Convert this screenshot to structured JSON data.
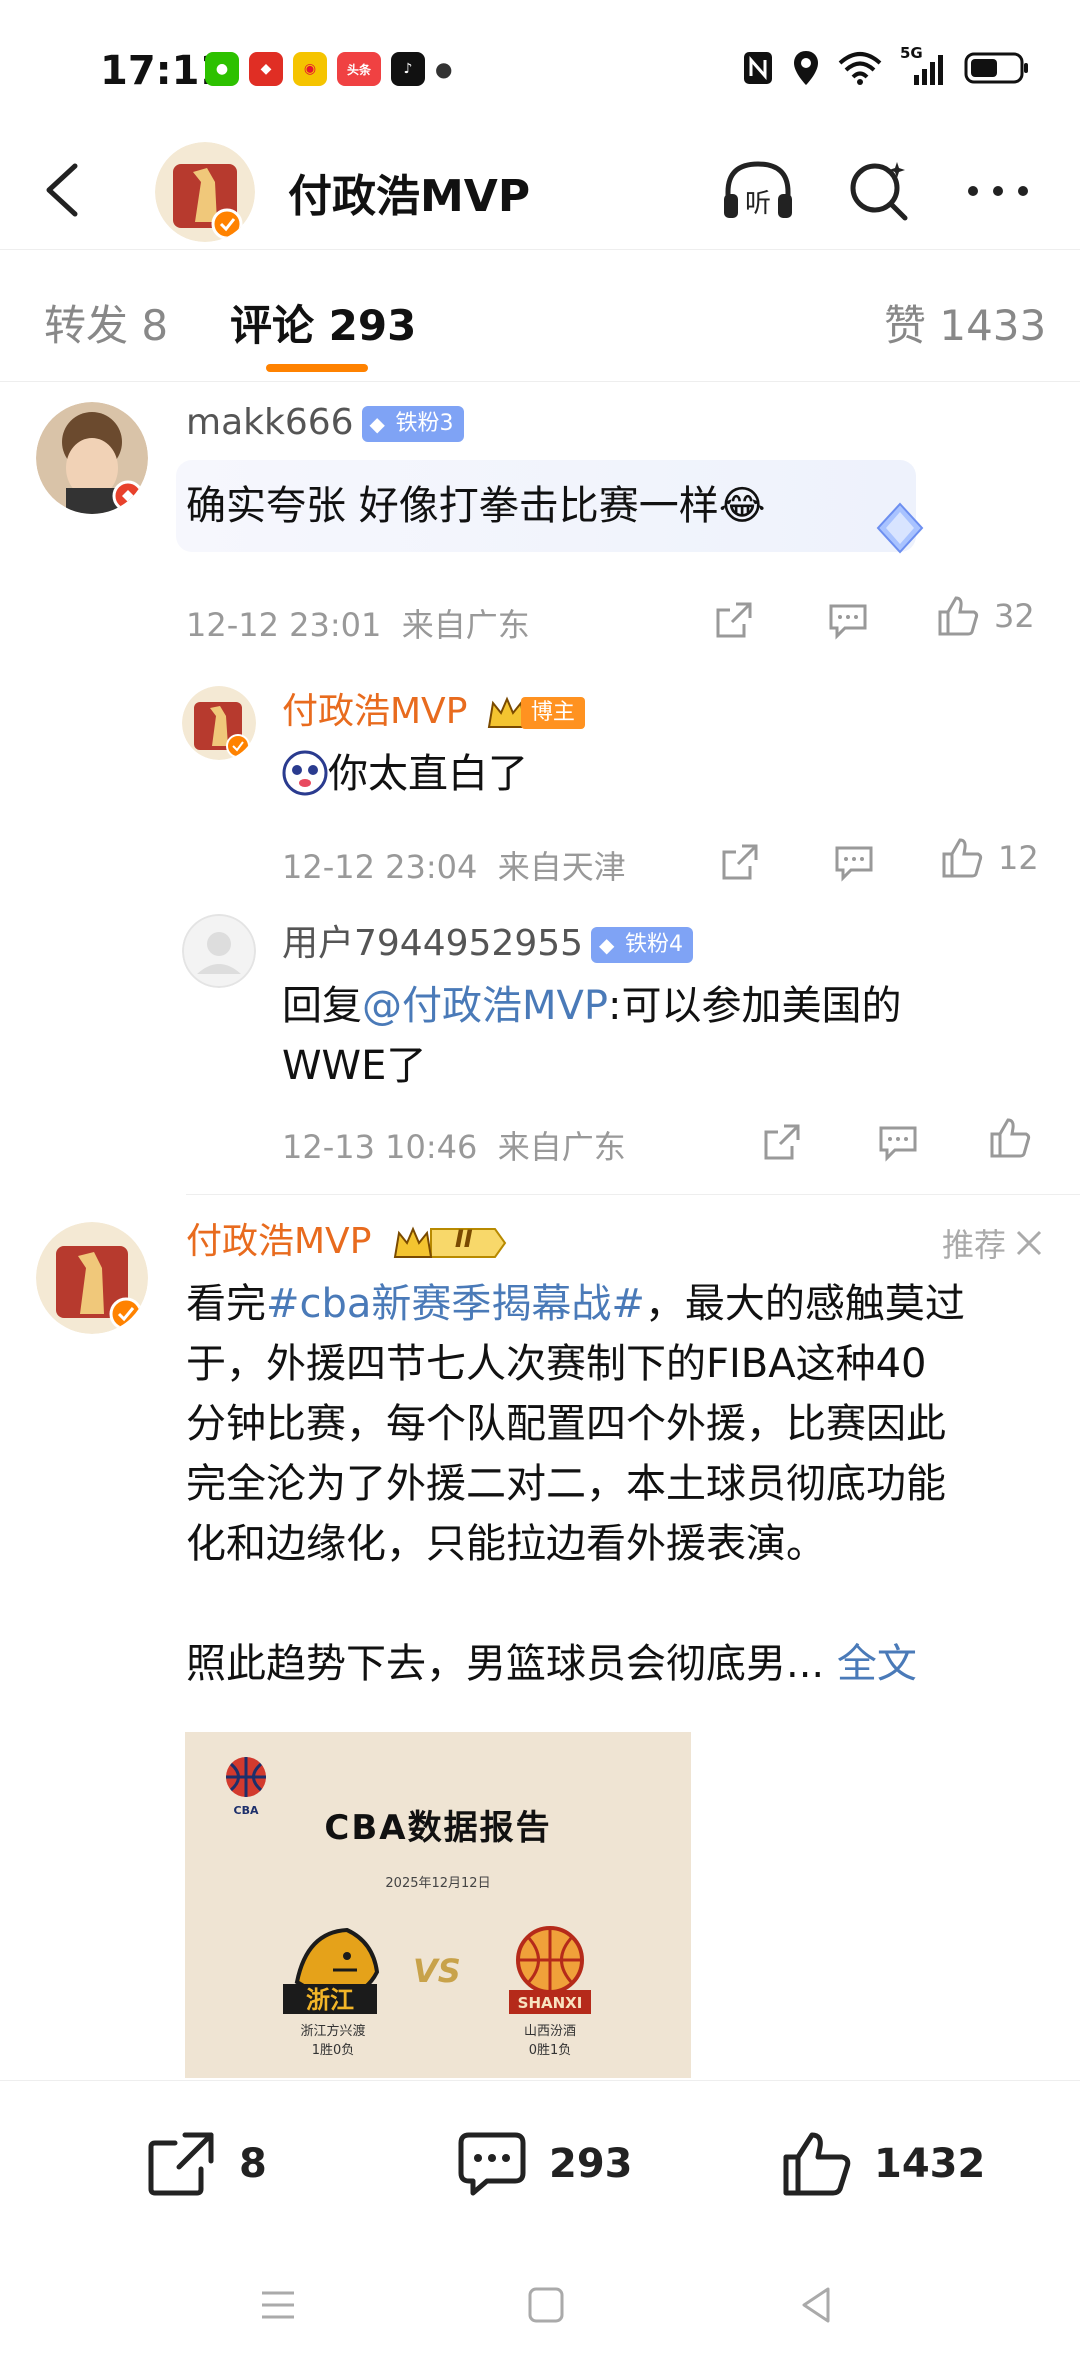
{
  "status": {
    "time": "17:11",
    "network": "5G"
  },
  "header": {
    "title": "付政浩MVP",
    "back_icon": "back-icon",
    "listen_label": "听"
  },
  "tabs": [
    {
      "label": "转发 8"
    },
    {
      "label": "评论 293"
    },
    {
      "label": "赞 1433"
    }
  ],
  "comments": [
    {
      "user": "makk666",
      "badge": "铁粉3",
      "text": "确实夸张 好像打拳击比赛一样😂",
      "time": "12-12 23:01",
      "location": "来自广东",
      "likes": "32"
    },
    {
      "user": "付政浩MVP",
      "badge": "博主",
      "text": "你太直白了",
      "time": "12-12 23:04",
      "location": "来自天津",
      "likes": "12"
    },
    {
      "user": "用户7944952955",
      "badge": "铁粉4",
      "reply_prefix": "回复",
      "reply_to": "@付政浩MVP",
      "text_line1": ":可以参加美国的",
      "text_line2": "WWE了",
      "time": "12-13 10:46",
      "location": "来自广东"
    }
  ],
  "post": {
    "user": "付政浩MVP",
    "rank_label": "II",
    "recommend": "推荐",
    "lines": [
      "看完#cba新赛季揭幕战#，最大的感触莫过",
      "于，外援四节七人次赛制下的FIBA这种40",
      "分钟比赛，每个队配置四个外援，比赛因此",
      "完全沦为了外援二对二，本土球员彻底功能",
      "化和边缘化，只能拉边看外援表演。"
    ],
    "hashtag": "#cba新赛季揭幕战#",
    "line1_prefix": "看完",
    "line1_suffix": "，最大的感触莫过",
    "last_line": "照此趋势下去，男篮球员会彻底男...",
    "full_text_link": "全文",
    "report": {
      "logo": "CBA",
      "title": "CBA数据报告",
      "date": "2025年12月12日",
      "vs": "VS",
      "team1_name": "浙江方兴渡",
      "team1_record": "1胜0负",
      "team1_logo": "浙江",
      "team2_name": "山西汾酒",
      "team2_record": "0胜1负",
      "team2_logo": "SHANXI"
    }
  },
  "bottom": {
    "reposts": "8",
    "comments": "293",
    "likes": "1432"
  },
  "colors": {
    "accent": "#ff8200",
    "link": "#4a7ab8",
    "blogger": "#e86b1e",
    "fan_badge": "#7fa3f5"
  }
}
